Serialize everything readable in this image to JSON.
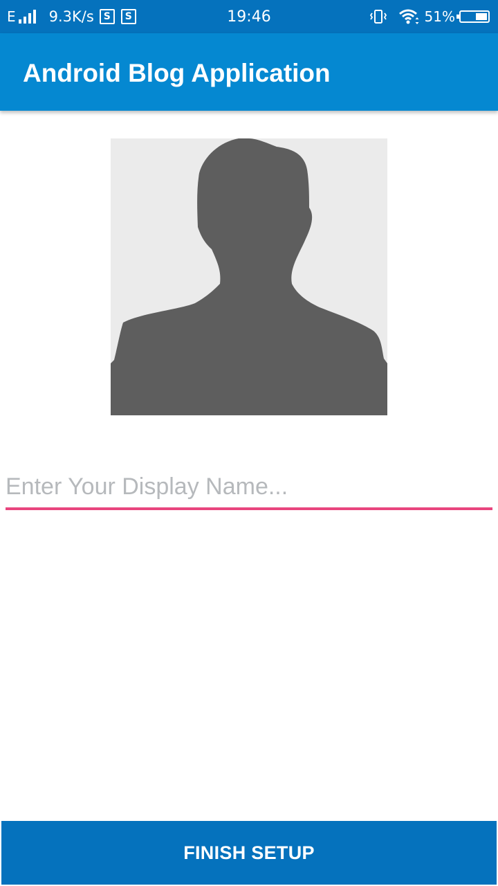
{
  "status_bar": {
    "network_type": "E",
    "speed": "9.3K/s",
    "notification_icons": [
      "S",
      "S"
    ],
    "time": "19:46",
    "battery_percent": "51%",
    "battery_level": 0.51
  },
  "app_bar": {
    "title": "Android Blog Application"
  },
  "profile": {
    "avatar_icon": "person-silhouette-icon"
  },
  "name_input": {
    "placeholder": "Enter Your Display Name...",
    "value": ""
  },
  "finish_button": {
    "label": "FINISH SETUP"
  },
  "colors": {
    "status_bar": "#0572bd",
    "app_bar": "#0588d1",
    "accent_underline": "#e8457e",
    "button": "#0572bd",
    "avatar_bg": "#ebebeb",
    "avatar_silhouette": "#5e5e5e"
  }
}
